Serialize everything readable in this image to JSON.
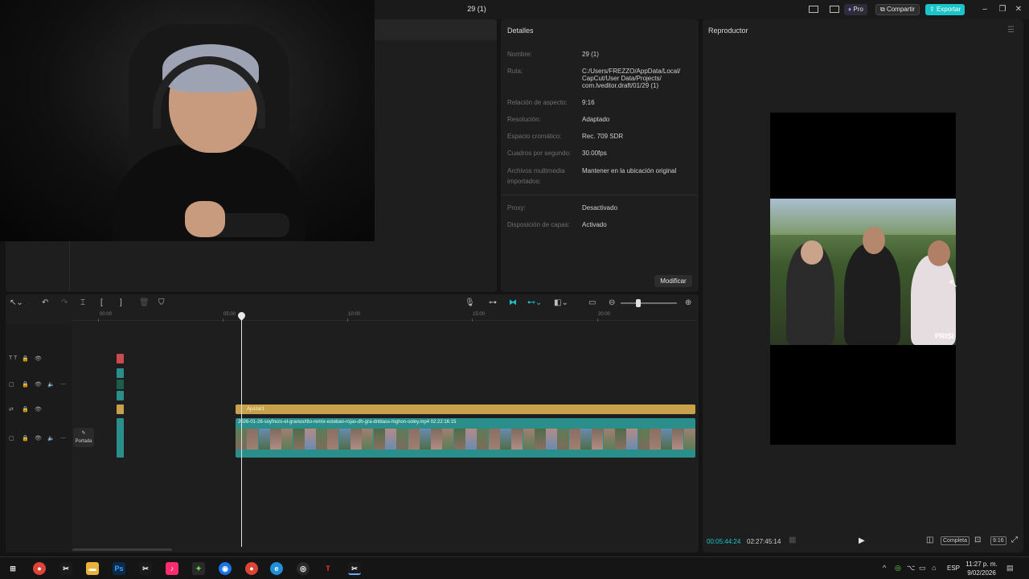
{
  "window": {
    "title": "29 (1)",
    "pro_label": "Pro",
    "share_label": "Compartir",
    "export_label": "Exportar",
    "accent_color": "#19c5c8"
  },
  "details": {
    "title": "Detalles",
    "rows": [
      {
        "label": "Nombre:",
        "value": "29 (1)"
      },
      {
        "label": "Ruta:",
        "value": "C:/Users/FREZZO/AppData/Local/ CapCut/User Data/Projects/ com.lveditor.draft/01/29 (1)"
      },
      {
        "label": "Relación de aspecto:",
        "value": "9:16"
      },
      {
        "label": "Resolución:",
        "value": "Adaptado"
      },
      {
        "label": "Espacio cromático:",
        "value": "Rec. 709 SDR"
      },
      {
        "label": "Cuadros por segundo:",
        "value": "30.00fps"
      },
      {
        "label": "Archivos multimedia importados:",
        "value": "Mantener en la ubicación original"
      },
      {
        "label": "Proxy:",
        "value": "Desactivado"
      },
      {
        "label": "Disposición de capas:",
        "value": "Activado"
      }
    ],
    "modify_label": "Modificar"
  },
  "player": {
    "title": "Reproductor",
    "watermark": "PRISI",
    "time_current": "00:05:44:24",
    "time_total": "02:27:45:14",
    "full_label": "Completa",
    "ratio_label": "9:16"
  },
  "timeline": {
    "ruler": [
      "00:00",
      "05:00",
      "10:00",
      "15:00",
      "20:00"
    ],
    "cover_label": "Portada",
    "adjust_clip_label": "Ajustar1",
    "video_clip_label": "2026-01-26-soyfrezo-el-granos/tito-remix-esteban-rojas-dh-gra-dnblass-highon-soley.mp4   02:22:16:15"
  },
  "taskbar": {
    "time": "11:27 p. m.",
    "date": "9/02/2026",
    "lang": "ESP"
  }
}
